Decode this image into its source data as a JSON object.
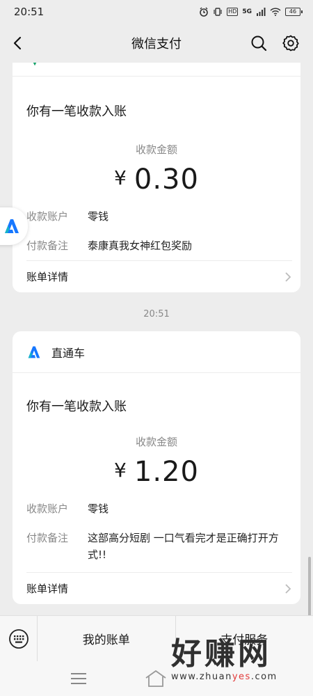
{
  "status_bar": {
    "time": "20:51",
    "network": "5G",
    "hd": "HD",
    "battery": "46"
  },
  "nav": {
    "title": "微信支付"
  },
  "card1": {
    "notice": "你有一笔收款入账",
    "amount_label": "收款金额",
    "currency": "¥",
    "amount": "0.30",
    "account_label": "收款账户",
    "account_value": "零钱",
    "remark_label": "付款备注",
    "remark_value": "泰康真我女神红包奖励",
    "detail_label": "账单详情"
  },
  "timestamp": "20:51",
  "card2": {
    "app_name": "直通车",
    "notice": "你有一笔收款入账",
    "amount_label": "收款金额",
    "currency": "¥",
    "amount": "1.20",
    "account_label": "收款账户",
    "account_value": "零钱",
    "remark_label": "付款备注",
    "remark_value": "这部高分短剧 一口气看完才是正确打开方式!!",
    "detail_label": "账单详情"
  },
  "bottom_tabs": [
    {
      "label": "我的账单"
    },
    {
      "label": "支付服务"
    }
  ],
  "watermark": {
    "big": "好赚网",
    "url_prefix": "www.zhuan",
    "url_red": "yes",
    "url_suffix": ".com"
  },
  "colors": {
    "brand_blue": "#1677ff",
    "brand_cyan": "#17b3c9",
    "background": "#ededed"
  }
}
